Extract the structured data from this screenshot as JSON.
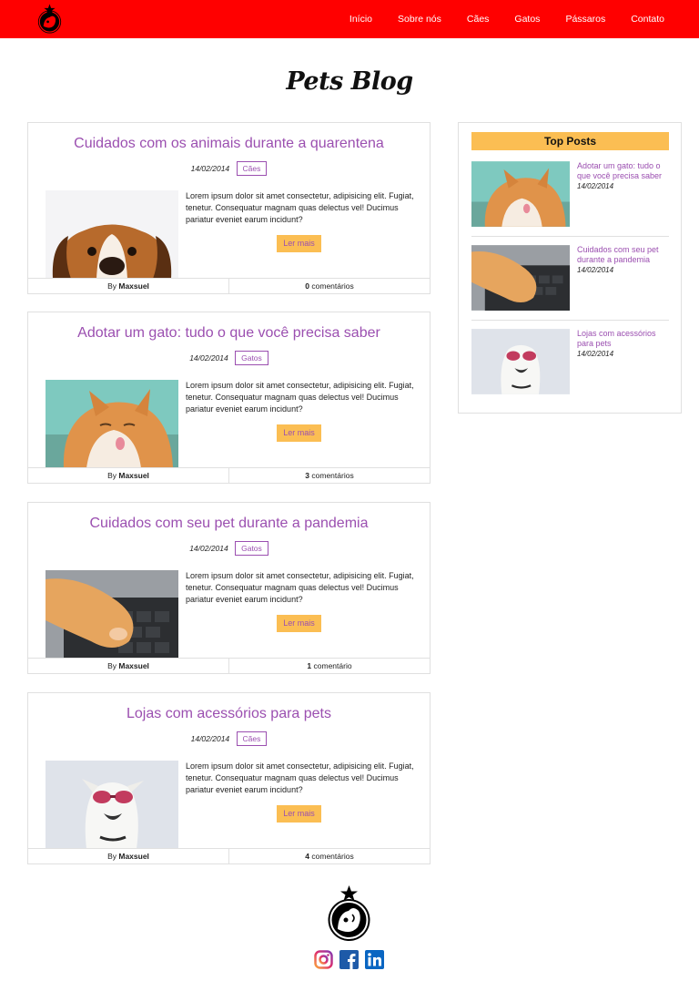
{
  "nav": {
    "items": [
      "Início",
      "Sobre nós",
      "Cães",
      "Gatos",
      "Pássaros",
      "Contato"
    ]
  },
  "blog_title": "Pets Blog",
  "posts": [
    {
      "title": "Cuidados com os animais durante a quarentena",
      "date": "14/02/2014",
      "category": "Cães",
      "excerpt": "Lorem ipsum dolor sit amet consectetur, adipisicing elit. Fugiat, tenetur. Consequatur magnam quas delectus vel! Ducimus pariatur eveniet earum incidunt?",
      "read_more": "Ler mais",
      "by": "By",
      "author": "Maxsuel",
      "comment_count": "0",
      "comment_label": "comentários"
    },
    {
      "title": "Adotar um gato: tudo o que você precisa saber",
      "date": "14/02/2014",
      "category": "Gatos",
      "excerpt": "Lorem ipsum dolor sit amet consectetur, adipisicing elit. Fugiat, tenetur. Consequatur magnam quas delectus vel! Ducimus pariatur eveniet earum incidunt?",
      "read_more": "Ler mais",
      "by": "By",
      "author": "Maxsuel",
      "comment_count": "3",
      "comment_label": "comentários"
    },
    {
      "title": "Cuidados com seu pet durante a pandemia",
      "date": "14/02/2014",
      "category": "Gatos",
      "excerpt": "Lorem ipsum dolor sit amet consectetur, adipisicing elit. Fugiat, tenetur. Consequatur magnam quas delectus vel! Ducimus pariatur eveniet earum incidunt?",
      "read_more": "Ler mais",
      "by": "By",
      "author": "Maxsuel",
      "comment_count": "1",
      "comment_label": "comentário"
    },
    {
      "title": "Lojas com acessórios para pets",
      "date": "14/02/2014",
      "category": "Cães",
      "excerpt": "Lorem ipsum dolor sit amet consectetur, adipisicing elit. Fugiat, tenetur. Consequatur magnam quas delectus vel! Ducimus pariatur eveniet earum incidunt?",
      "read_more": "Ler mais",
      "by": "By",
      "author": "Maxsuel",
      "comment_count": "4",
      "comment_label": "comentários"
    }
  ],
  "sidebar": {
    "title": "Top Posts",
    "items": [
      {
        "title": "Adotar um gato: tudo o que você precisa saber",
        "date": "14/02/2014"
      },
      {
        "title": "Cuidados com seu pet durante a pandemia",
        "date": "14/02/2014"
      },
      {
        "title": "Lojas com acessórios para pets",
        "date": "14/02/2014"
      }
    ]
  },
  "footer": {
    "social": [
      "instagram-icon",
      "facebook-icon",
      "linkedin-icon"
    ]
  },
  "colors": {
    "header": "#ff0000",
    "accent": "#9b4fb0",
    "button": "#fbbe53"
  }
}
